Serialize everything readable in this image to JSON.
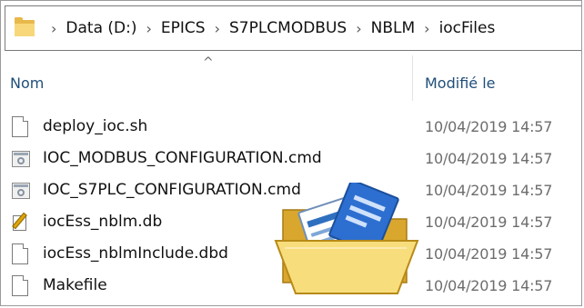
{
  "addressbar": {
    "crumbs": [
      "Data (D:)",
      "EPICS",
      "S7PLCMODBUS",
      "NBLM",
      "iocFiles"
    ],
    "separator": "›",
    "folder_icon": "folder-icon"
  },
  "columns": {
    "name": "Nom",
    "date_modified": "Modifié le",
    "sort_indicator": "^"
  },
  "files": [
    {
      "name": "deploy_ioc.sh",
      "date": "10/04/2019 14:57",
      "icon": "blank-file-icon"
    },
    {
      "name": "IOC_MODBUS_CONFIGURATION.cmd",
      "date": "10/04/2019 14:57",
      "icon": "cmd-file-icon"
    },
    {
      "name": "IOC_S7PLC_CONFIGURATION.cmd",
      "date": "10/04/2019 14:57",
      "icon": "cmd-file-icon"
    },
    {
      "name": "iocEss_nblm.db",
      "date": "10/04/2019 14:57",
      "icon": "db-file-icon"
    },
    {
      "name": "iocEss_nblmInclude.dbd",
      "date": "10/04/2019 14:57",
      "icon": "blank-file-icon"
    },
    {
      "name": "Makefile",
      "date": "10/04/2019 14:57",
      "icon": "blank-file-icon"
    }
  ],
  "colors": {
    "header_text": "#1f4e79",
    "date_text": "#6d6d6d",
    "folder": "#f7d77a"
  }
}
